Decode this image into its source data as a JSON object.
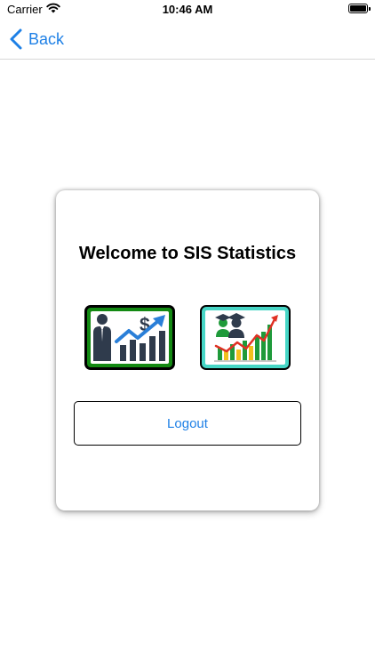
{
  "status_bar": {
    "carrier": "Carrier",
    "time": "10:46 AM"
  },
  "nav": {
    "back_label": "Back"
  },
  "card": {
    "title": "Welcome to SIS Statistics",
    "tiles": [
      {
        "icon": "finance-statistics-icon"
      },
      {
        "icon": "student-statistics-icon"
      }
    ],
    "logout_label": "Logout"
  },
  "colors": {
    "accent": "#1e80e6",
    "finance_tile_border": "#138a13",
    "students_tile_border": "#47d6c6"
  }
}
